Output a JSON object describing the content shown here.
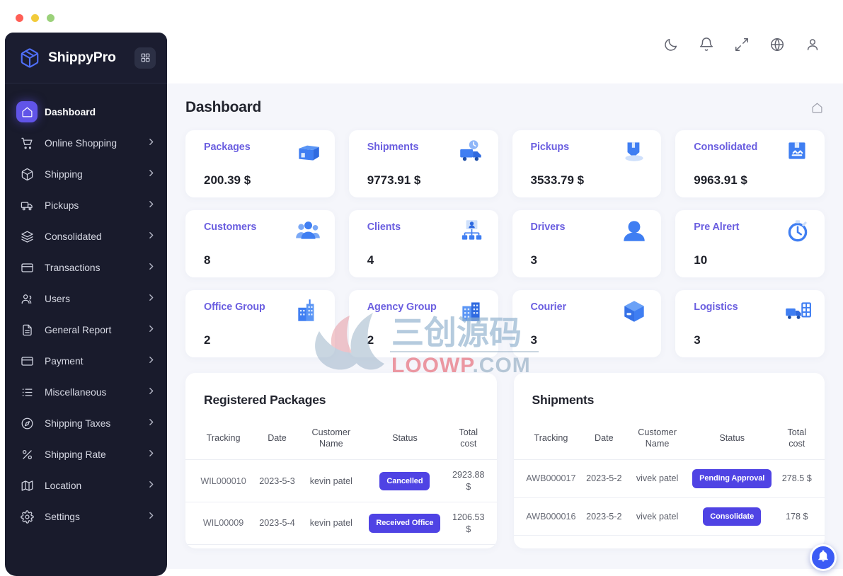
{
  "window": {
    "traffic_lights": [
      "close",
      "minimize",
      "maximize"
    ]
  },
  "sidebar": {
    "brand": "ShippyPro",
    "brand_logo_icon": "package-box-icon",
    "grid_toggle_icon": "grid-menu-icon",
    "items": [
      {
        "label": "Dashboard",
        "icon": "home-icon",
        "active": true,
        "chevron": false
      },
      {
        "label": "Online Shopping",
        "icon": "cart-icon",
        "active": false,
        "chevron": true
      },
      {
        "label": "Shipping",
        "icon": "box-icon",
        "active": false,
        "chevron": true
      },
      {
        "label": "Pickups",
        "icon": "truck-icon",
        "active": false,
        "chevron": true
      },
      {
        "label": "Consolidated",
        "icon": "layers-icon",
        "active": false,
        "chevron": true
      },
      {
        "label": "Transactions",
        "icon": "card-icon",
        "active": false,
        "chevron": true
      },
      {
        "label": "Users",
        "icon": "users-icon",
        "active": false,
        "chevron": true
      },
      {
        "label": "General Report",
        "icon": "document-icon",
        "active": false,
        "chevron": true
      },
      {
        "label": "Payment",
        "icon": "card-icon",
        "active": false,
        "chevron": true
      },
      {
        "label": "Miscellaneous",
        "icon": "list-icon",
        "active": false,
        "chevron": true
      },
      {
        "label": "Shipping Taxes",
        "icon": "compass-icon",
        "active": false,
        "chevron": true
      },
      {
        "label": "Shipping Rate",
        "icon": "percent-icon",
        "active": false,
        "chevron": true
      },
      {
        "label": "Location",
        "icon": "map-icon",
        "active": false,
        "chevron": true
      },
      {
        "label": "Settings",
        "icon": "gear-icon",
        "active": false,
        "chevron": true
      }
    ]
  },
  "topbar": {
    "icons": [
      {
        "name": "moon-icon"
      },
      {
        "name": "bell-icon"
      },
      {
        "name": "expand-icon"
      },
      {
        "name": "globe-icon"
      },
      {
        "name": "user-icon"
      }
    ]
  },
  "page": {
    "title": "Dashboard",
    "home_icon": "home-breadcrumb-icon"
  },
  "stats": [
    {
      "label": "Packages",
      "value": "200.39 $",
      "icon": "open-box-icon"
    },
    {
      "label": "Shipments",
      "value": "9773.91 $",
      "icon": "delivery-truck-icon"
    },
    {
      "label": "Pickups",
      "value": "3533.79 $",
      "icon": "package-pickup-icon"
    },
    {
      "label": "Consolidated",
      "value": "9963.91 $",
      "icon": "consolidated-box-icon"
    },
    {
      "label": "Customers",
      "value": "8",
      "icon": "people-group-icon"
    },
    {
      "label": "Clients",
      "value": "4",
      "icon": "org-chart-icon"
    },
    {
      "label": "Drivers",
      "value": "3",
      "icon": "driver-person-icon"
    },
    {
      "label": "Pre Alrert",
      "value": "10",
      "icon": "stopwatch-icon"
    },
    {
      "label": "Office Group",
      "value": "2",
      "icon": "office-building-icon"
    },
    {
      "label": "Agency Group",
      "value": "2",
      "icon": "agency-building-icon"
    },
    {
      "label": "Courier",
      "value": "3",
      "icon": "cube-box-icon"
    },
    {
      "label": "Logistics",
      "value": "3",
      "icon": "logistics-truck-icon"
    }
  ],
  "tables": {
    "registered_packages": {
      "title": "Registered Packages",
      "columns": [
        "Tracking",
        "Date",
        "Customer Name",
        "Status",
        "Total cost"
      ],
      "rows": [
        {
          "tracking": "WIL000010",
          "date": "2023-5-3",
          "customer": "kevin patel",
          "status": "Cancelled",
          "cost": "2923.88 $"
        },
        {
          "tracking": "WIL00009",
          "date": "2023-5-4",
          "customer": "kevin patel",
          "status": "Received Office",
          "cost": "1206.53 $"
        }
      ]
    },
    "shipments": {
      "title": "Shipments",
      "columns": [
        "Tracking",
        "Date",
        "Customer Name",
        "Status",
        "Total cost"
      ],
      "rows": [
        {
          "tracking": "AWB000017",
          "date": "2023-5-2",
          "customer": "vivek patel",
          "status": "Pending Approval",
          "cost": "278.5 $"
        },
        {
          "tracking": "AWB000016",
          "date": "2023-5-2",
          "customer": "vivek patel",
          "status": "Consolidate",
          "cost": "178 $"
        }
      ]
    }
  },
  "watermark": {
    "cjk_text": "三创源码",
    "domain_text": "LOOWP.COM"
  },
  "fab": {
    "icon": "notification-bell-icon"
  },
  "colors": {
    "sidebar_bg": "#191b2c",
    "accent_purple": "#6154e8",
    "badge_blue": "#4f43e4",
    "stat_label": "#6b5fe0",
    "page_bg": "#f5f6fb",
    "icon_blue": "#3b7ef0"
  }
}
